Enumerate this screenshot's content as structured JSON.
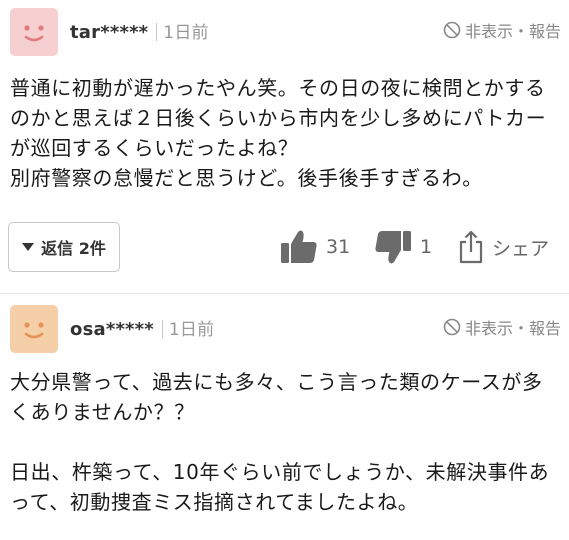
{
  "comments": [
    {
      "username": "tar*****",
      "time": "1日前",
      "hide_report": "非表示・報告",
      "body": "普通に初動が遅かったやん笑。その日の夜に検問とかするのかと思えば２日後くらいから市内を少し多めにパトカーが巡回するくらいだったよね？\n別府警察の怠慢だと思うけど。後手後手すぎるわ。",
      "reply_label": "返信 2件",
      "likes": "31",
      "dislikes": "1",
      "share_label": "シェア",
      "avatar_color": "#f6cfd0",
      "avatar_feature_color": "#e17a7f"
    },
    {
      "username": "osa*****",
      "time": "1日前",
      "hide_report": "非表示・報告",
      "body": "大分県警って、過去にも多々、こう言った類のケースが多くありませんか？？\n\n日出、杵築って、10年ぐらい前でしょうか、未解決事件あって、初動捜査ミス指摘されてましたよね。",
      "avatar_color": "#f5cfa8",
      "avatar_feature_color": "#e59356"
    }
  ],
  "colors": {
    "icon_gray": "#6b6b6b",
    "text_gray": "#999999"
  }
}
